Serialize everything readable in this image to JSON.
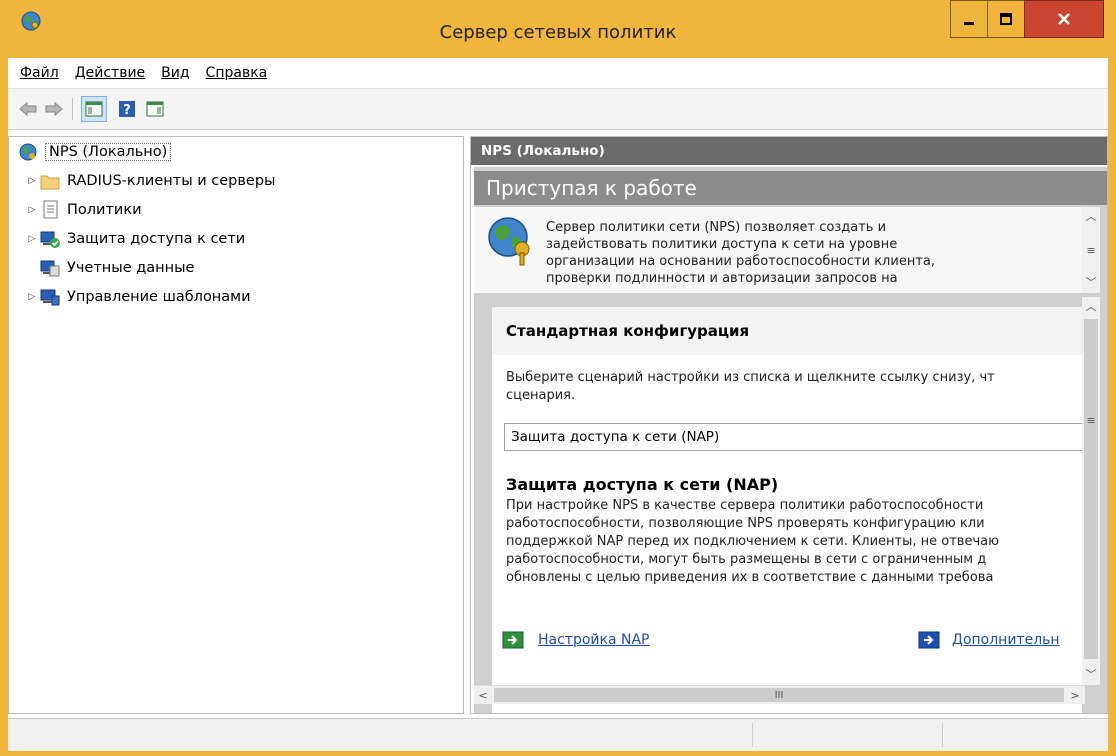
{
  "window": {
    "title": "Сервер сетевых политик",
    "minimize_label": "_",
    "maximize_label": "□",
    "close_label": "x",
    "accent_color": "#f0b53d",
    "close_color": "#c9452f"
  },
  "menu": {
    "items": [
      "Файл",
      "Действие",
      "Вид",
      "Справка"
    ]
  },
  "toolbar": {
    "icons": [
      "back-arrow-icon",
      "forward-arrow-icon",
      "show-hide-console-tree-icon",
      "help-icon",
      "show-action-pane-icon"
    ]
  },
  "tree": {
    "root": "NPS (Локально)",
    "items": [
      {
        "label": "RADIUS-клиенты и серверы",
        "icon": "folder-icon",
        "expandable": true
      },
      {
        "label": "Политики",
        "icon": "policy-document-icon",
        "expandable": true
      },
      {
        "label": "Защита доступа к сети",
        "icon": "network-protection-icon",
        "expandable": true
      },
      {
        "label": "Учетные данные",
        "icon": "accounting-icon",
        "expandable": false
      },
      {
        "label": "Управление шаблонами",
        "icon": "templates-icon",
        "expandable": true
      }
    ]
  },
  "right_pane": {
    "header": "NPS (Локально)",
    "getting_started": "Приступая к работе",
    "intro_lines": [
      "Сервер политики сети (NPS) позволяет создать и",
      "задействовать политики доступа к сети на уровне",
      "организации на основании работоспособности клиента,",
      "проверки подлинности и авторизации запросов на"
    ],
    "standard_config": {
      "title": "Стандартная конфигурация",
      "desc_lines": [
        "Выберите сценарий настройки из списка и щелкните ссылку снизу, чт",
        "сценария."
      ],
      "combo_value": "Защита доступа к сети (NAP)",
      "nap_title": "Защита доступа к сети (NAP)",
      "nap_lines": [
        "При настройке NPS в качестве сервера политики работоспособности",
        "работоспособности, позволяющие NPS проверять конфигурацию кли",
        "поддержкой NAP перед их подключением к сети. Клиенты, не отвечаю",
        "работоспособности, могут быть размещены в сети с ограниченным д",
        "обновлены с целью приведения их в соответствие с данными требова"
      ],
      "link_configure": "Настройка NAP",
      "link_more": "Дополнительн"
    }
  },
  "scroll": {
    "hscroll_thumb": "III"
  }
}
